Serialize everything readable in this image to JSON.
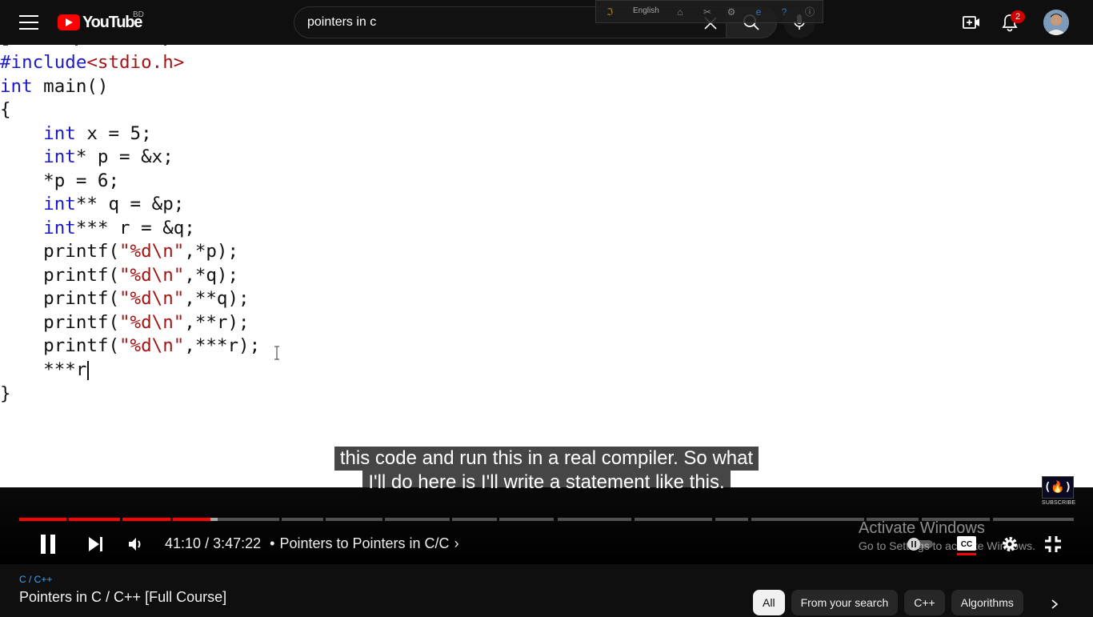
{
  "header": {
    "logo_text": "YouTube",
    "country_code": "BD",
    "search_value": "pointers in c",
    "notification_count": "2",
    "ime_language": "English"
  },
  "player": {
    "code_lines": [
      {
        "segments": [
          {
            "t": "#include",
            "c": "pp"
          },
          {
            "t": "<stdio.h>",
            "c": "str"
          }
        ]
      },
      {
        "segments": [
          {
            "t": "int",
            "c": "kw"
          },
          {
            "t": " main()",
            "c": ""
          }
        ]
      },
      {
        "segments": [
          {
            "t": "{",
            "c": ""
          }
        ]
      },
      {
        "segments": [
          {
            "t": "    ",
            "c": ""
          },
          {
            "t": "int",
            "c": "kw"
          },
          {
            "t": " x = 5;",
            "c": ""
          }
        ]
      },
      {
        "segments": [
          {
            "t": "    ",
            "c": ""
          },
          {
            "t": "int",
            "c": "kw"
          },
          {
            "t": "* p = &x;",
            "c": ""
          }
        ]
      },
      {
        "segments": [
          {
            "t": "    *p = 6;",
            "c": ""
          }
        ]
      },
      {
        "segments": [
          {
            "t": "    ",
            "c": ""
          },
          {
            "t": "int",
            "c": "kw"
          },
          {
            "t": "** q = &p;",
            "c": ""
          }
        ]
      },
      {
        "segments": [
          {
            "t": "    ",
            "c": ""
          },
          {
            "t": "int",
            "c": "kw"
          },
          {
            "t": "*** r = &q;",
            "c": ""
          }
        ]
      },
      {
        "segments": [
          {
            "t": "    printf(",
            "c": ""
          },
          {
            "t": "\"%d\\n\"",
            "c": "str"
          },
          {
            "t": ",*p);",
            "c": ""
          }
        ]
      },
      {
        "segments": [
          {
            "t": "    printf(",
            "c": ""
          },
          {
            "t": "\"%d\\n\"",
            "c": "str"
          },
          {
            "t": ",*q);",
            "c": ""
          }
        ]
      },
      {
        "segments": [
          {
            "t": "    printf(",
            "c": ""
          },
          {
            "t": "\"%d\\n\"",
            "c": "str"
          },
          {
            "t": ",**q);",
            "c": ""
          }
        ]
      },
      {
        "segments": [
          {
            "t": "    printf(",
            "c": ""
          },
          {
            "t": "\"%d\\n\"",
            "c": "str"
          },
          {
            "t": ",**r);",
            "c": ""
          }
        ]
      },
      {
        "segments": [
          {
            "t": "    printf(",
            "c": ""
          },
          {
            "t": "\"%d\\n\"",
            "c": "str"
          },
          {
            "t": ",***r);",
            "c": ""
          }
        ]
      },
      {
        "segments": [
          {
            "t": "    ***r",
            "c": ""
          }
        ],
        "caret": true
      },
      {
        "segments": [
          {
            "t": "}",
            "c": ""
          }
        ]
      }
    ],
    "captions": [
      "this code and run this in a real compiler. So what",
      "I'll do here is I'll write a statement like this."
    ],
    "channel_badge_text": "SUBSCRIBE",
    "current_time": "41:10",
    "duration": "3:47:22",
    "chapter_separator": "•",
    "chapter_title": "Pointers to Pointers in C/C",
    "progress_fraction": 0.181,
    "buffered_fraction": 0.188,
    "watermark_line1": "Activate Windows",
    "watermark_line2": "Go to Settings to activate Windows."
  },
  "below": {
    "breadcrumb": "C / C++",
    "title": "Pointers in C / C++ [Full Course]",
    "chips": [
      "All",
      "From your search",
      "C++",
      "Algorithms"
    ]
  },
  "colors": {
    "brand_red": "#ff0000",
    "link_blue": "#3ea6ff",
    "code_keyword": "#1a1acc",
    "code_string": "#a31515"
  }
}
